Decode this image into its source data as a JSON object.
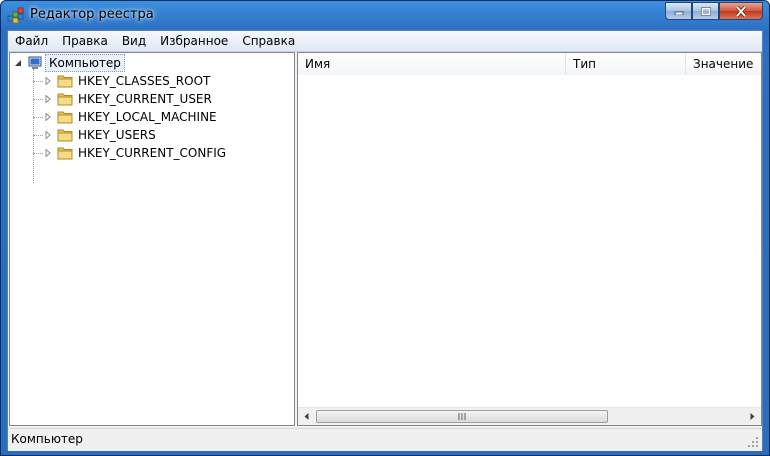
{
  "window": {
    "title": "Редактор реестра"
  },
  "menu": [
    "Файл",
    "Правка",
    "Вид",
    "Избранное",
    "Справка"
  ],
  "tree": {
    "root": {
      "label": "Компьютер",
      "icon": "computer-icon"
    },
    "children": [
      {
        "label": "HKEY_CLASSES_ROOT",
        "icon": "folder-icon"
      },
      {
        "label": "HKEY_CURRENT_USER",
        "icon": "folder-icon"
      },
      {
        "label": "HKEY_LOCAL_MACHINE",
        "icon": "folder-icon"
      },
      {
        "label": "HKEY_USERS",
        "icon": "folder-icon"
      },
      {
        "label": "HKEY_CURRENT_CONFIG",
        "icon": "folder-icon"
      }
    ]
  },
  "list": {
    "columns": [
      "Имя",
      "Тип",
      "Значение"
    ],
    "rows": []
  },
  "status": {
    "text": "Компьютер"
  },
  "colors": {
    "titlebar": "#2b6fc2",
    "close_button": "#c03b1f",
    "folder": "#e8c25b"
  }
}
